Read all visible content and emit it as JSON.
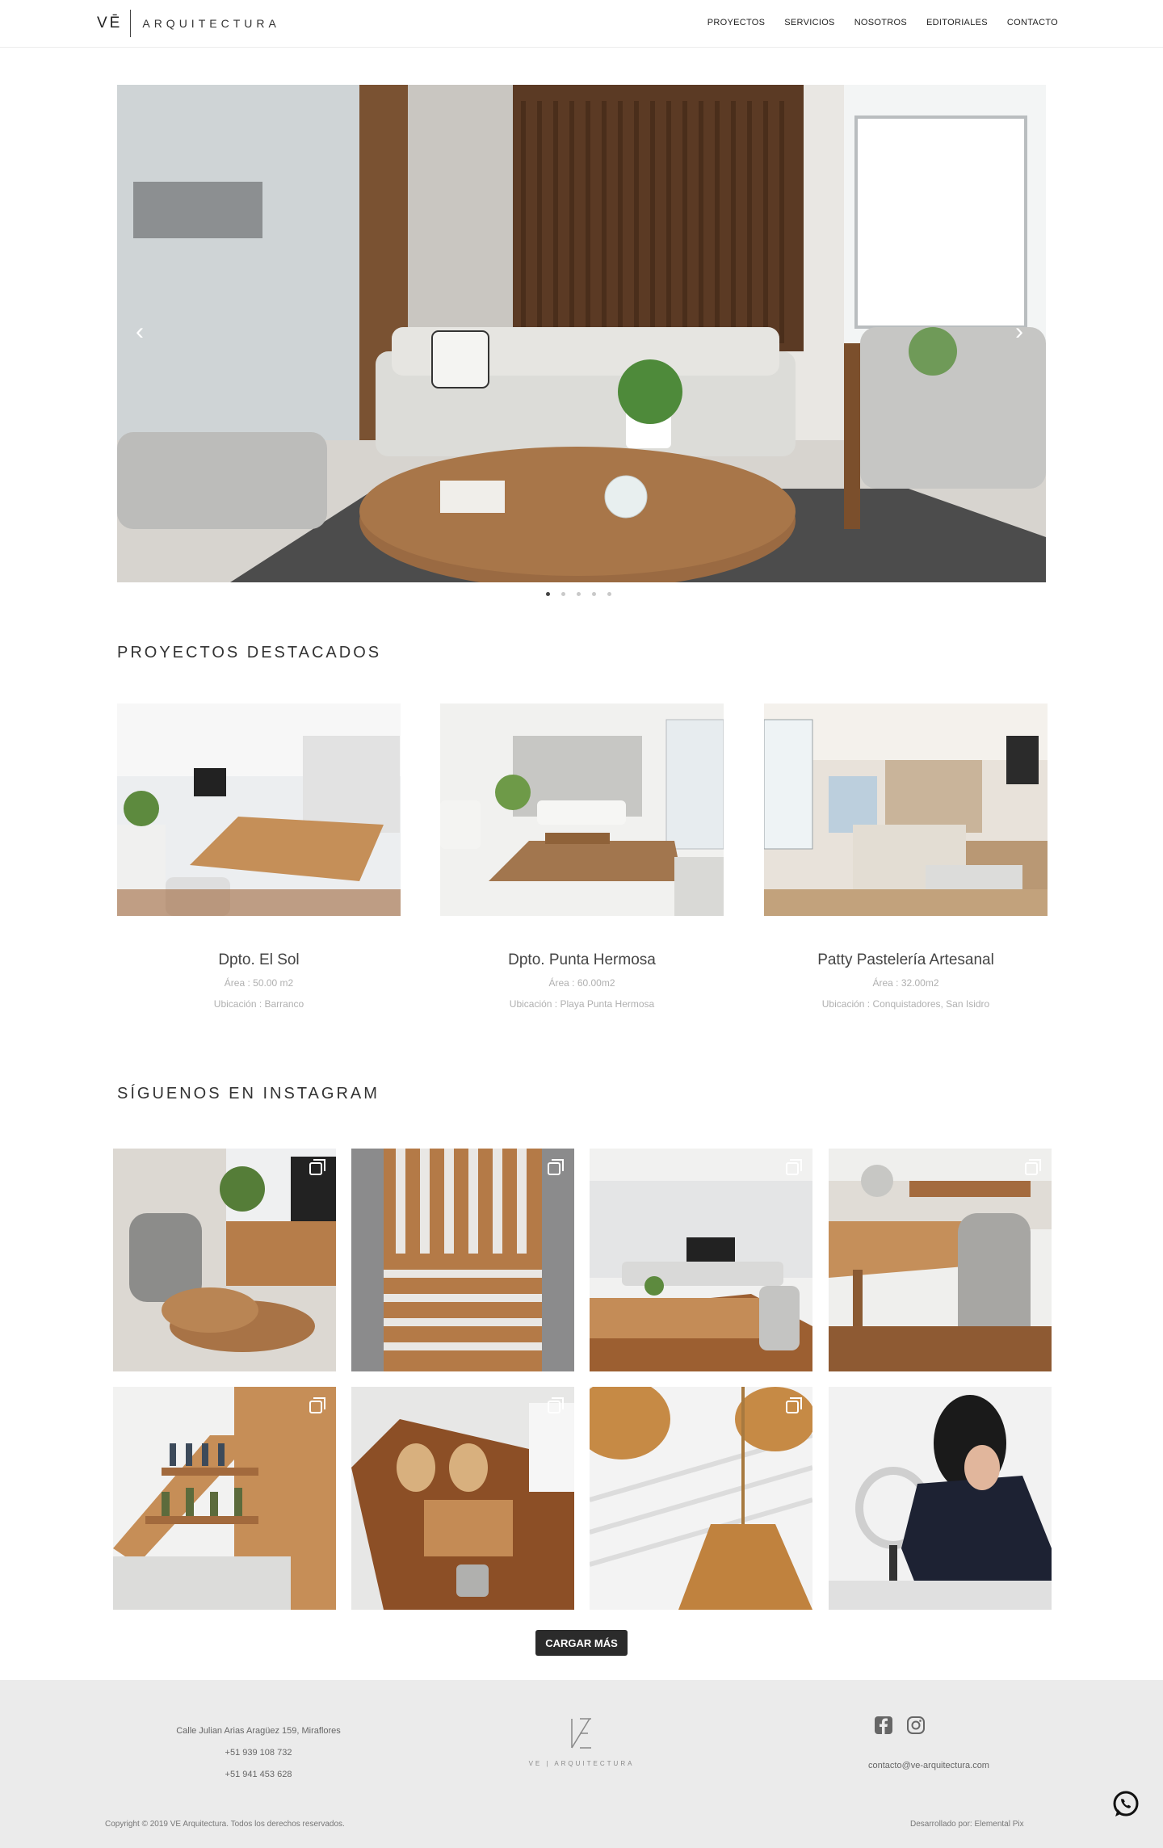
{
  "header": {
    "logo_mark": "VĒ",
    "logo_name": "ARQUITECTURA",
    "nav": [
      "PROYECTOS",
      "SERVICIOS",
      "NOSOTROS",
      "EDITORIALES",
      "CONTACTO"
    ]
  },
  "slider": {
    "prev_icon": "chevron-left-icon",
    "next_icon": "chevron-right-icon",
    "prev_glyph": "‹",
    "next_glyph": "›",
    "slide_count": 5,
    "active_slide": 1
  },
  "featured": {
    "title": "PROYECTOS DESTACADOS",
    "projects": [
      {
        "name": "Dpto. El Sol",
        "area": "Área : 50.00 m2",
        "location": "Ubicación : Barranco"
      },
      {
        "name": "Dpto. Punta Hermosa",
        "area": "Área : 60.00m2",
        "location": "Ubicación : Playa Punta Hermosa"
      },
      {
        "name": "Patty Pastelería Artesanal",
        "area": "Área : 32.00m2",
        "location": "Ubicación : Conquistadores, San Isidro"
      }
    ]
  },
  "instagram": {
    "title": "SÍGUENOS EN INSTAGRAM",
    "load_more": "CARGAR MÁS"
  },
  "footer": {
    "address": "Calle Julian Arias Aragüez 159, Miraflores",
    "phone1": "+51 939 108 732",
    "phone2": "+51 941 453 628",
    "logo_name": "VE | ARQUITECTURA",
    "email": "contacto@ve-arquitectura.com",
    "copyright": "Copyright © 2019 VE Arquitectura. Todos los derechos reservados.",
    "developer": "Desarrollado por: Elemental Pix",
    "social_icons": [
      "facebook-icon",
      "instagram-icon"
    ]
  },
  "colors": {
    "dark_button": "#2b2b2b",
    "footer_bg": "#ebebeb",
    "wood": "#9a6a42",
    "sofa": "#dcdcd8"
  }
}
